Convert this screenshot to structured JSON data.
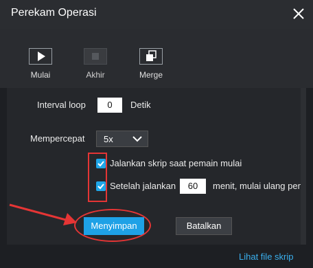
{
  "window": {
    "title": "Perekam Operasi"
  },
  "toolbar": {
    "start_label": "Mulai",
    "end_label": "Akhir",
    "merge_label": "Merge"
  },
  "settings": {
    "interval_label": "Interval loop",
    "interval_value": "0",
    "interval_unit": "Detik",
    "speed_label": "Mempercepat",
    "speed_value": "5x",
    "run_on_start_label": "Jalankan skrip saat pemain mulai",
    "run_on_start_checked": true,
    "after_run_prefix": "Setelah jalankan",
    "after_run_value": "60",
    "after_run_suffix": "menit, mulai ulang pema",
    "after_run_checked": true
  },
  "actions": {
    "save_label": "Menyimpan",
    "cancel_label": "Batalkan"
  },
  "footer": {
    "view_scripts_link": "Lihat file skrip"
  },
  "colors": {
    "accent": "#1ea1e6",
    "annotation_red": "#e53535",
    "link": "#3ab0ef"
  }
}
